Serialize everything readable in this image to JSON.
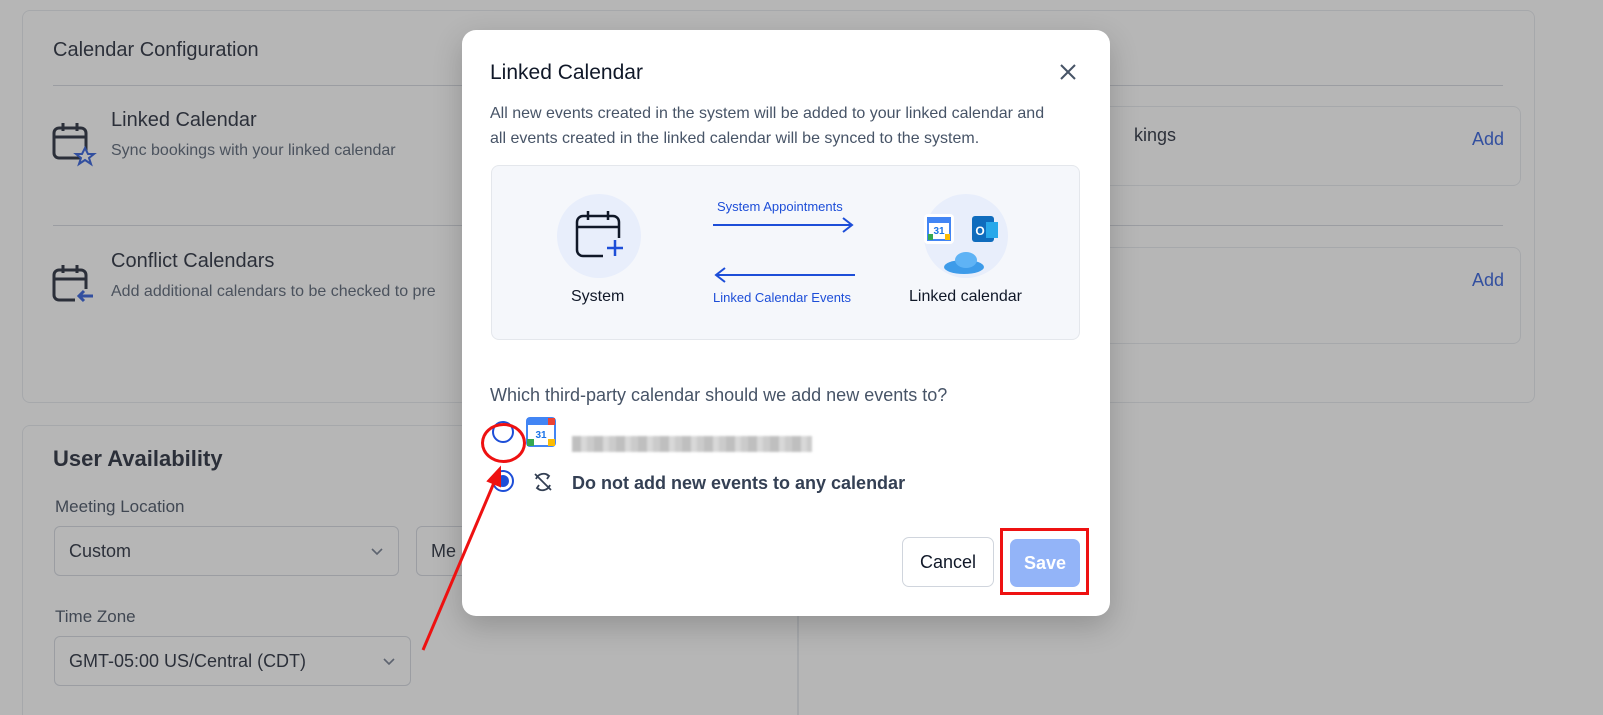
{
  "background": {
    "config_card": {
      "title": "Calendar Configuration",
      "linked": {
        "title": "Linked Calendar",
        "subtitle": "Sync bookings with your linked calendar"
      },
      "conflict": {
        "title": "Conflict Calendars",
        "subtitle": "Add additional calendars to be checked to pre"
      },
      "right_top_text": "kings",
      "add_label": "Add"
    },
    "availability": {
      "title": "User Availability",
      "meeting_location_label": "Meeting Location",
      "meeting_location_value": "Custom",
      "second_select_value": "Me",
      "time_zone_label": "Time Zone",
      "time_zone_value": "GMT-05:00 US/Central (CDT)"
    }
  },
  "modal": {
    "title": "Linked Calendar",
    "description": "All new events created in the system will be added to your linked calendar and all events created in the linked calendar will be synced to the system.",
    "diagram": {
      "left_label": "System",
      "right_label": "Linked calendar",
      "top_arrow_label": "System Appointments",
      "bottom_arrow_label": "Linked Calendar Events",
      "google_badge": "31"
    },
    "question": "Which third-party calendar should we add new events to?",
    "options": [
      {
        "selected": false
      },
      {
        "label": "Do not add new events to any calendar",
        "selected": true
      }
    ],
    "cancel_label": "Cancel",
    "save_label": "Save"
  },
  "colors": {
    "accent": "#1d4ed8",
    "save_disabled": "#93b4f8",
    "annotation_red": "#ee1111"
  }
}
